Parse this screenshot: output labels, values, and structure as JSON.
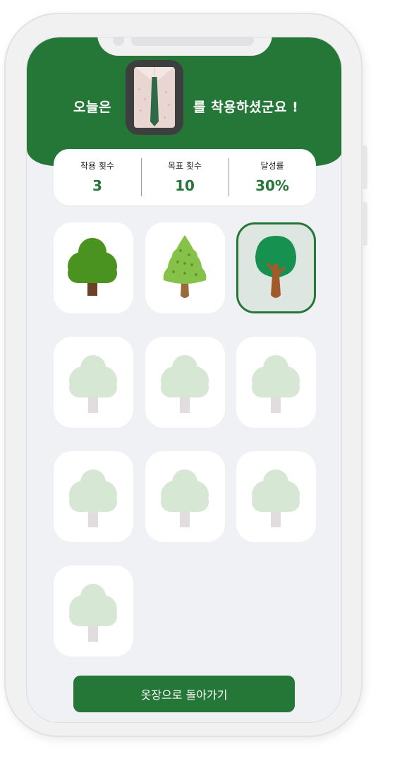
{
  "header": {
    "prefix_text": "오늘은",
    "suffix_text": "를 착용하셨군요 !",
    "clothing_image": "shirt-with-green-tie"
  },
  "stats": [
    {
      "label": "착용 횟수",
      "value": "3"
    },
    {
      "label": "목표 횟수",
      "value": "10"
    },
    {
      "label": "달성률",
      "value": "30%"
    }
  ],
  "trees": [
    {
      "kind": "round-green-tree",
      "state": "earned"
    },
    {
      "kind": "pine-tree",
      "state": "earned"
    },
    {
      "kind": "big-green-tree",
      "state": "selected"
    },
    {
      "kind": "locked-tree",
      "state": "locked"
    },
    {
      "kind": "locked-tree",
      "state": "locked"
    },
    {
      "kind": "locked-tree",
      "state": "locked"
    },
    {
      "kind": "locked-tree",
      "state": "locked"
    },
    {
      "kind": "locked-tree",
      "state": "locked"
    },
    {
      "kind": "locked-tree",
      "state": "locked"
    },
    {
      "kind": "locked-tree",
      "state": "locked"
    }
  ],
  "back_button": {
    "label": "옷장으로 돌아가기"
  },
  "colors": {
    "accent": "#247737",
    "background": "#f0f1f5",
    "locked_tree": "#d6e8d3"
  }
}
